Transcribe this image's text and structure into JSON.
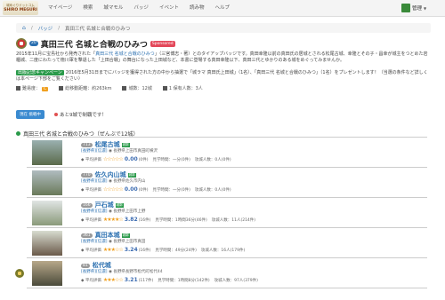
{
  "app": {
    "logo_top": "城めぐりドットコム",
    "logo_bottom": "SHIRO MEGURI"
  },
  "nav": [
    "マイページ",
    "検索",
    "城マモル",
    "バッジ",
    "イベント",
    "読み物",
    "ヘルプ"
  ],
  "user": {
    "name": "管理"
  },
  "breadcrumb": {
    "home_icon": "home-icon",
    "items": [
      "バッジ",
      "真田三代 名城と合戦のひみつ"
    ]
  },
  "badge": {
    "count": "20",
    "title": "真田三代 名城と合戦のひみつ",
    "sponsored": "Sponsored"
  },
  "desc": {
    "p1": "2015年11月に宝島社から発売された「",
    "link": "真田三代 名城と合戦のひみつ",
    "p2": "」（三宮博志・著）とのタイアップバッジです。真田幸隆以前の真田氏の居城とされる松尾古城、幸隆とその子・昌幸が城主をつとめた岩櫃城、二度にわたって徳川軍を撃退した「上田合戦」の舞台になった上田城など、本書に登場する真田幸隆以下、真田三代とゆかりのある城をめぐってみませんか。"
  },
  "campaign": {
    "tag": "出版記念キャンペーン",
    "text": "2016年5月31日までにバッジを獲得された方の中から抽選で「城ラマ 真田氏上田城」（1名）、「真田三代 名城と合戦のひみつ」（1名）をプレゼントします！（当選の条件など詳しくは本ページ下部をご覧ください）"
  },
  "stats": {
    "difficulty_label": "難易度：",
    "difficulty": "C",
    "distance": "総移動距離：約263km",
    "castles": "城数：12城",
    "holders": "1 保有人数：3人"
  },
  "actions": {
    "current": "現在",
    "status": "挑戦中",
    "message": "あと9城で制覇です！"
  },
  "section": {
    "title": "真田三代 名城と合戦のひみつ（ぜんぶで12城）"
  },
  "castles": [
    {
      "num": "713",
      "name": "松尾古城",
      "level": "城郭",
      "pref": "[長野県][信濃]",
      "addr": "長野県上田市真田町横沢",
      "score": "0.00",
      "reviews": "(0件)",
      "time": "見学時間：一分",
      "time_c": "(0件)",
      "visitors": "攻城人数：0人",
      "visitors_c": "(0件)",
      "stars": "☆☆☆☆☆"
    },
    {
      "num": "770",
      "name": "佐久内山城",
      "level": "城郭",
      "pref": "[長野県][信濃]",
      "addr": "長野県佐久市内山",
      "score": "0.00",
      "reviews": "(0件)",
      "time": "見学時間：一分",
      "time_c": "(0件)",
      "visitors": "攻城人数：0人",
      "visitors_c": "(0件)",
      "stars": "☆☆☆☆☆"
    },
    {
      "num": "166",
      "name": "戸石城",
      "level": "城郭",
      "pref": "[長野県][信濃]",
      "addr": "長野県上田市上野",
      "score": "3.82",
      "reviews": "(16件)",
      "time": "見学時間：1時間36分",
      "time_c": "(46件)",
      "visitors": "攻城人数：11人",
      "visitors_c": "(214件)",
      "stars": "★★★★☆"
    },
    {
      "num": "361",
      "name": "真田本城",
      "level": "城郭",
      "pref": "[長野県][信濃]",
      "addr": "長野県上田市真田",
      "score": "3.24",
      "reviews": "(16件)",
      "time": "見学時間：49分",
      "time_c": "(24件)",
      "visitors": "攻城人数：16人",
      "visitors_c": "(179件)",
      "stars": "★★★☆☆"
    },
    {
      "num": "81",
      "name": "松代城",
      "level": "",
      "pref": "[長野県][信濃]",
      "addr": "長野県長野市松代町松代44",
      "score": "3.21",
      "reviews": "(117件)",
      "time": "見学時間：1時間8分",
      "time_c": "(142件)",
      "visitors": "攻城人数：97人",
      "visitors_c": "(379件)",
      "stars": "★★★☆☆"
    }
  ]
}
